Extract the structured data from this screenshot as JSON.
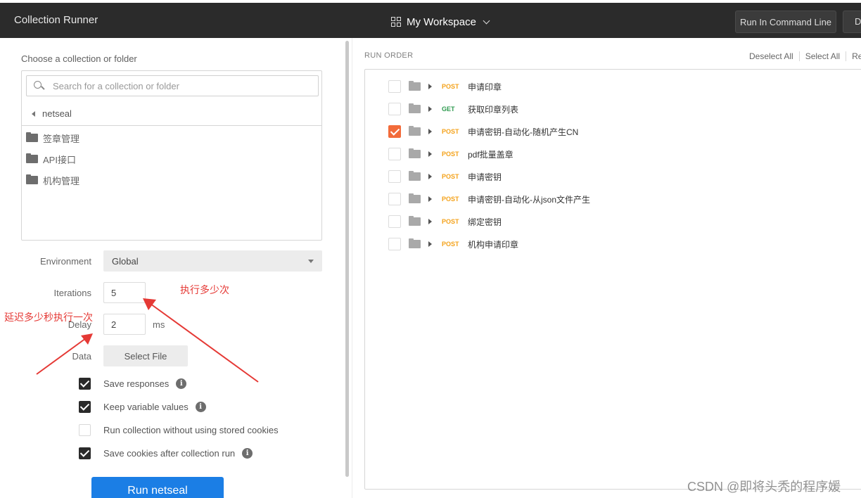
{
  "header": {
    "app_title": "Collection Runner",
    "workspace_label": "My Workspace",
    "run_cmd_label": "Run In Command Line",
    "docs_label": "D"
  },
  "left": {
    "choose_label": "Choose a collection or folder",
    "search_placeholder": "Search for a collection or folder",
    "breadcrumb": "netseal",
    "folders": [
      "签章管理",
      "API接口",
      "机构管理"
    ],
    "environment_label": "Environment",
    "environment_value": "Global",
    "iterations_label": "Iterations",
    "iterations_value": "5",
    "delay_label": "Delay",
    "delay_value": "2",
    "delay_unit": "ms",
    "data_label": "Data",
    "select_file_label": "Select File",
    "options": [
      {
        "label": "Save responses",
        "checked": true,
        "info": true
      },
      {
        "label": "Keep variable values",
        "checked": true,
        "info": true
      },
      {
        "label": "Run collection without using stored cookies",
        "checked": false,
        "info": false
      },
      {
        "label": "Save cookies after collection run",
        "checked": true,
        "info": true
      }
    ],
    "run_button_label": "Run netseal"
  },
  "annotations": {
    "iterations_note": "执行多少次",
    "delay_note": "延迟多少秒执行一次",
    "color": "#e53935"
  },
  "right": {
    "run_order_label": "RUN ORDER",
    "deselect_all": "Deselect All",
    "select_all": "Select All",
    "reset": "Re",
    "requests": [
      {
        "method": "POST",
        "name": "申请印章",
        "checked": false
      },
      {
        "method": "GET",
        "name": "获取印章列表",
        "checked": false
      },
      {
        "method": "POST",
        "name": "申请密钥-自动化-随机产生CN",
        "checked": true
      },
      {
        "method": "POST",
        "name": "pdf批量盖章",
        "checked": false
      },
      {
        "method": "POST",
        "name": "申请密钥",
        "checked": false
      },
      {
        "method": "POST",
        "name": "申请密钥-自动化-从json文件产生",
        "checked": false
      },
      {
        "method": "POST",
        "name": "绑定密钥",
        "checked": false
      },
      {
        "method": "POST",
        "name": "机构申请印章",
        "checked": false
      }
    ]
  },
  "watermark": "CSDN @即将头秃的程序媛",
  "colors": {
    "topbar": "#2b2b2b",
    "primary_button": "#1b7ee5",
    "checked_request": "#f26b3a",
    "post_method": "#f4a21a",
    "get_method": "#2e9a4f"
  }
}
